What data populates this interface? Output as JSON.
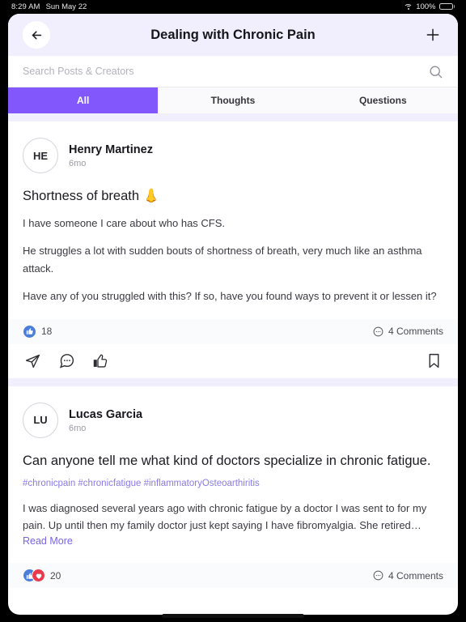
{
  "statusbar": {
    "time": "8:29 AM",
    "date": "Sun May 22",
    "battery": "100%",
    "wifi_icon": "wifi-icon",
    "battery_icon": "battery-full-icon"
  },
  "header": {
    "title": "Dealing with Chronic Pain",
    "back_icon": "arrow-left-icon",
    "add_icon": "plus-icon"
  },
  "search": {
    "placeholder": "Search Posts & Creators",
    "value": "",
    "icon": "search-icon"
  },
  "tabs": [
    {
      "label": "All",
      "active": true
    },
    {
      "label": "Thoughts",
      "active": false
    },
    {
      "label": "Questions",
      "active": false
    }
  ],
  "colors": {
    "accent": "#8258fc",
    "header_bg": "#f1effd",
    "band": "#f1effd",
    "stats_bg": "#fafbfd",
    "hashtag": "#8a7ae8",
    "link": "#7a63e8",
    "reaction_like": "#4b7ddb",
    "reaction_love": "#eb3a4d"
  },
  "posts": [
    {
      "avatar_initials": "HE",
      "author": "Henry Martinez",
      "timeago": "6mo",
      "title": "Shortness of breath 👃",
      "hashtags": "",
      "paragraphs": [
        "I have someone I care about who has CFS.",
        "He struggles a lot with sudden bouts of shortness of breath, very much like an asthma attack.",
        "Have any of you struggled with this? If so, have you found ways to prevent it or lessen it?"
      ],
      "read_more": "",
      "reaction_count": "18",
      "reactions": [
        "like"
      ],
      "comments": "4 Comments",
      "actions": {
        "share": "send-icon",
        "comment": "comment-icon",
        "like": "thumbs-up-icon",
        "bookmark": "bookmark-icon"
      }
    },
    {
      "avatar_initials": "LU",
      "author": "Lucas Garcia",
      "timeago": "6mo",
      "title": "Can anyone tell me what kind of doctors specialize in chronic fatigue.",
      "hashtags": "#chronicpain #chronicfatigue #inflammatoryOsteoarthiritis",
      "paragraphs": [
        "I was diagnosed several years ago with chronic fatigue by a doctor I was sent to for my pain. Up until then my family doctor just kept saying I have fibromyalgia. She retired…"
      ],
      "read_more": "Read More",
      "reaction_count": "20",
      "reactions": [
        "like",
        "love"
      ],
      "comments": "4 Comments",
      "actions": {
        "share": "send-icon",
        "comment": "comment-icon",
        "like": "thumbs-up-icon",
        "bookmark": "bookmark-icon"
      }
    }
  ]
}
